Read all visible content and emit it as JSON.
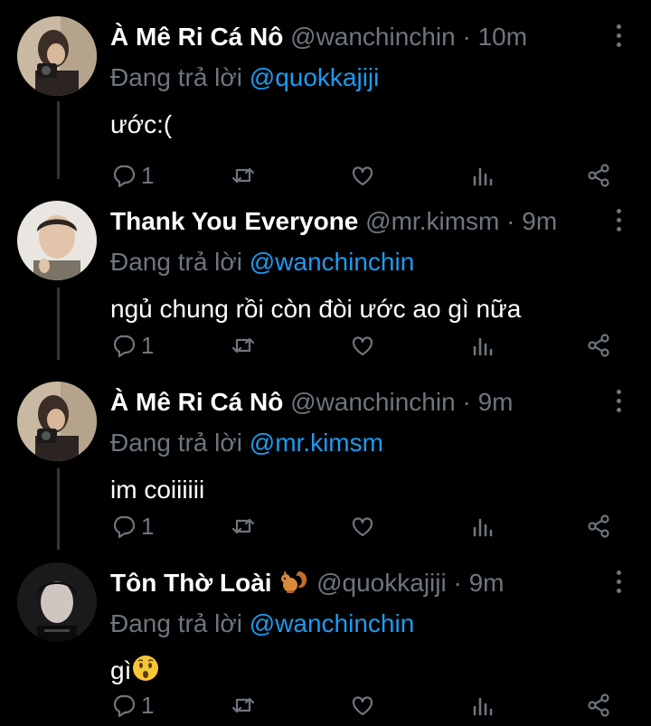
{
  "colors": {
    "background": "#000000",
    "secondary": "#6e767d",
    "link": "#1d9bf0",
    "thread": "#333639"
  },
  "replying_label": "Đang trả lời",
  "tweets": [
    {
      "name": "À Mê Ri Cá Nô",
      "handle": "@wanchinchin",
      "sep": "·",
      "time": "10m",
      "reply_to": "@quokkajiji",
      "text": "ước:(",
      "reply_count": "1",
      "avatar": "person-with-camera"
    },
    {
      "name": "Thank You Everyone",
      "handle": "@mr.kimsm",
      "sep": "·",
      "time": "9m",
      "reply_to": "@wanchinchin",
      "text": "ngủ chung rồi còn đòi ước ao gì nữa",
      "reply_count": "1",
      "avatar": "young-man-portrait"
    },
    {
      "name": "À Mê Ri Cá Nô",
      "handle": "@wanchinchin",
      "sep": "·",
      "time": "9m",
      "reply_to": "@mr.kimsm",
      "text": "im coiiiiii",
      "reply_count": "1",
      "avatar": "person-with-camera"
    },
    {
      "name": "Tôn Thờ Loài",
      "name_emoji": "squirrel",
      "handle": "@quokkajiji",
      "sep": "·",
      "time": "9m",
      "reply_to": "@wanchinchin",
      "text": "gì",
      "text_emoji": "surprised-face",
      "reply_count": "1",
      "avatar": "dark-portrait"
    }
  ]
}
